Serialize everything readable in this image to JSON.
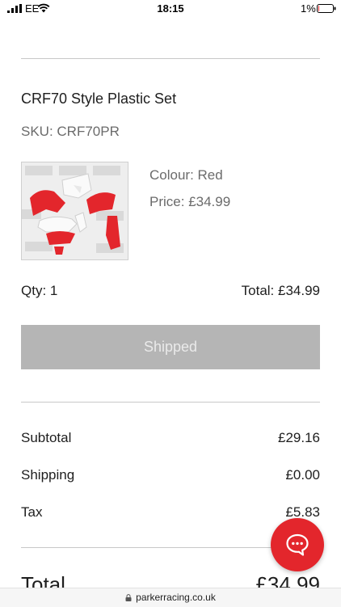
{
  "status_bar": {
    "carrier": "EE",
    "time": "18:15",
    "battery_percent": "1%",
    "battery_level": 0.01,
    "icons": [
      "signal-icon",
      "wifi-icon",
      "battery-icon"
    ]
  },
  "item": {
    "title": "CRF70 Style Plastic Set",
    "sku": "SKU: CRF70PR",
    "image_alt": "red-and-white-plastic-set-image",
    "colour_label": "Colour: ",
    "colour_value": "Red",
    "price_label": "Price: ",
    "price_value": "£34.99",
    "qty": "Qty: 1",
    "total": "Total: £34.99",
    "status": "Shipped"
  },
  "summary": {
    "subtotal_label": "Subtotal",
    "subtotal_value": "£29.16",
    "shipping_label": "Shipping",
    "shipping_value": "£0.00",
    "tax_label": "Tax",
    "tax_value": "£5.83",
    "total_label": "Total",
    "total_value": "£34.99"
  },
  "chat": {
    "icon": "chat-bubble-icon"
  },
  "browser": {
    "url": "parkerracing.co.uk",
    "icon": "lock-icon"
  },
  "colors": {
    "accent_red": "#e3262c",
    "status_button_bg": "#b5b5b5",
    "divider": "#c8c8c8",
    "muted_text": "#6b6b6b"
  }
}
